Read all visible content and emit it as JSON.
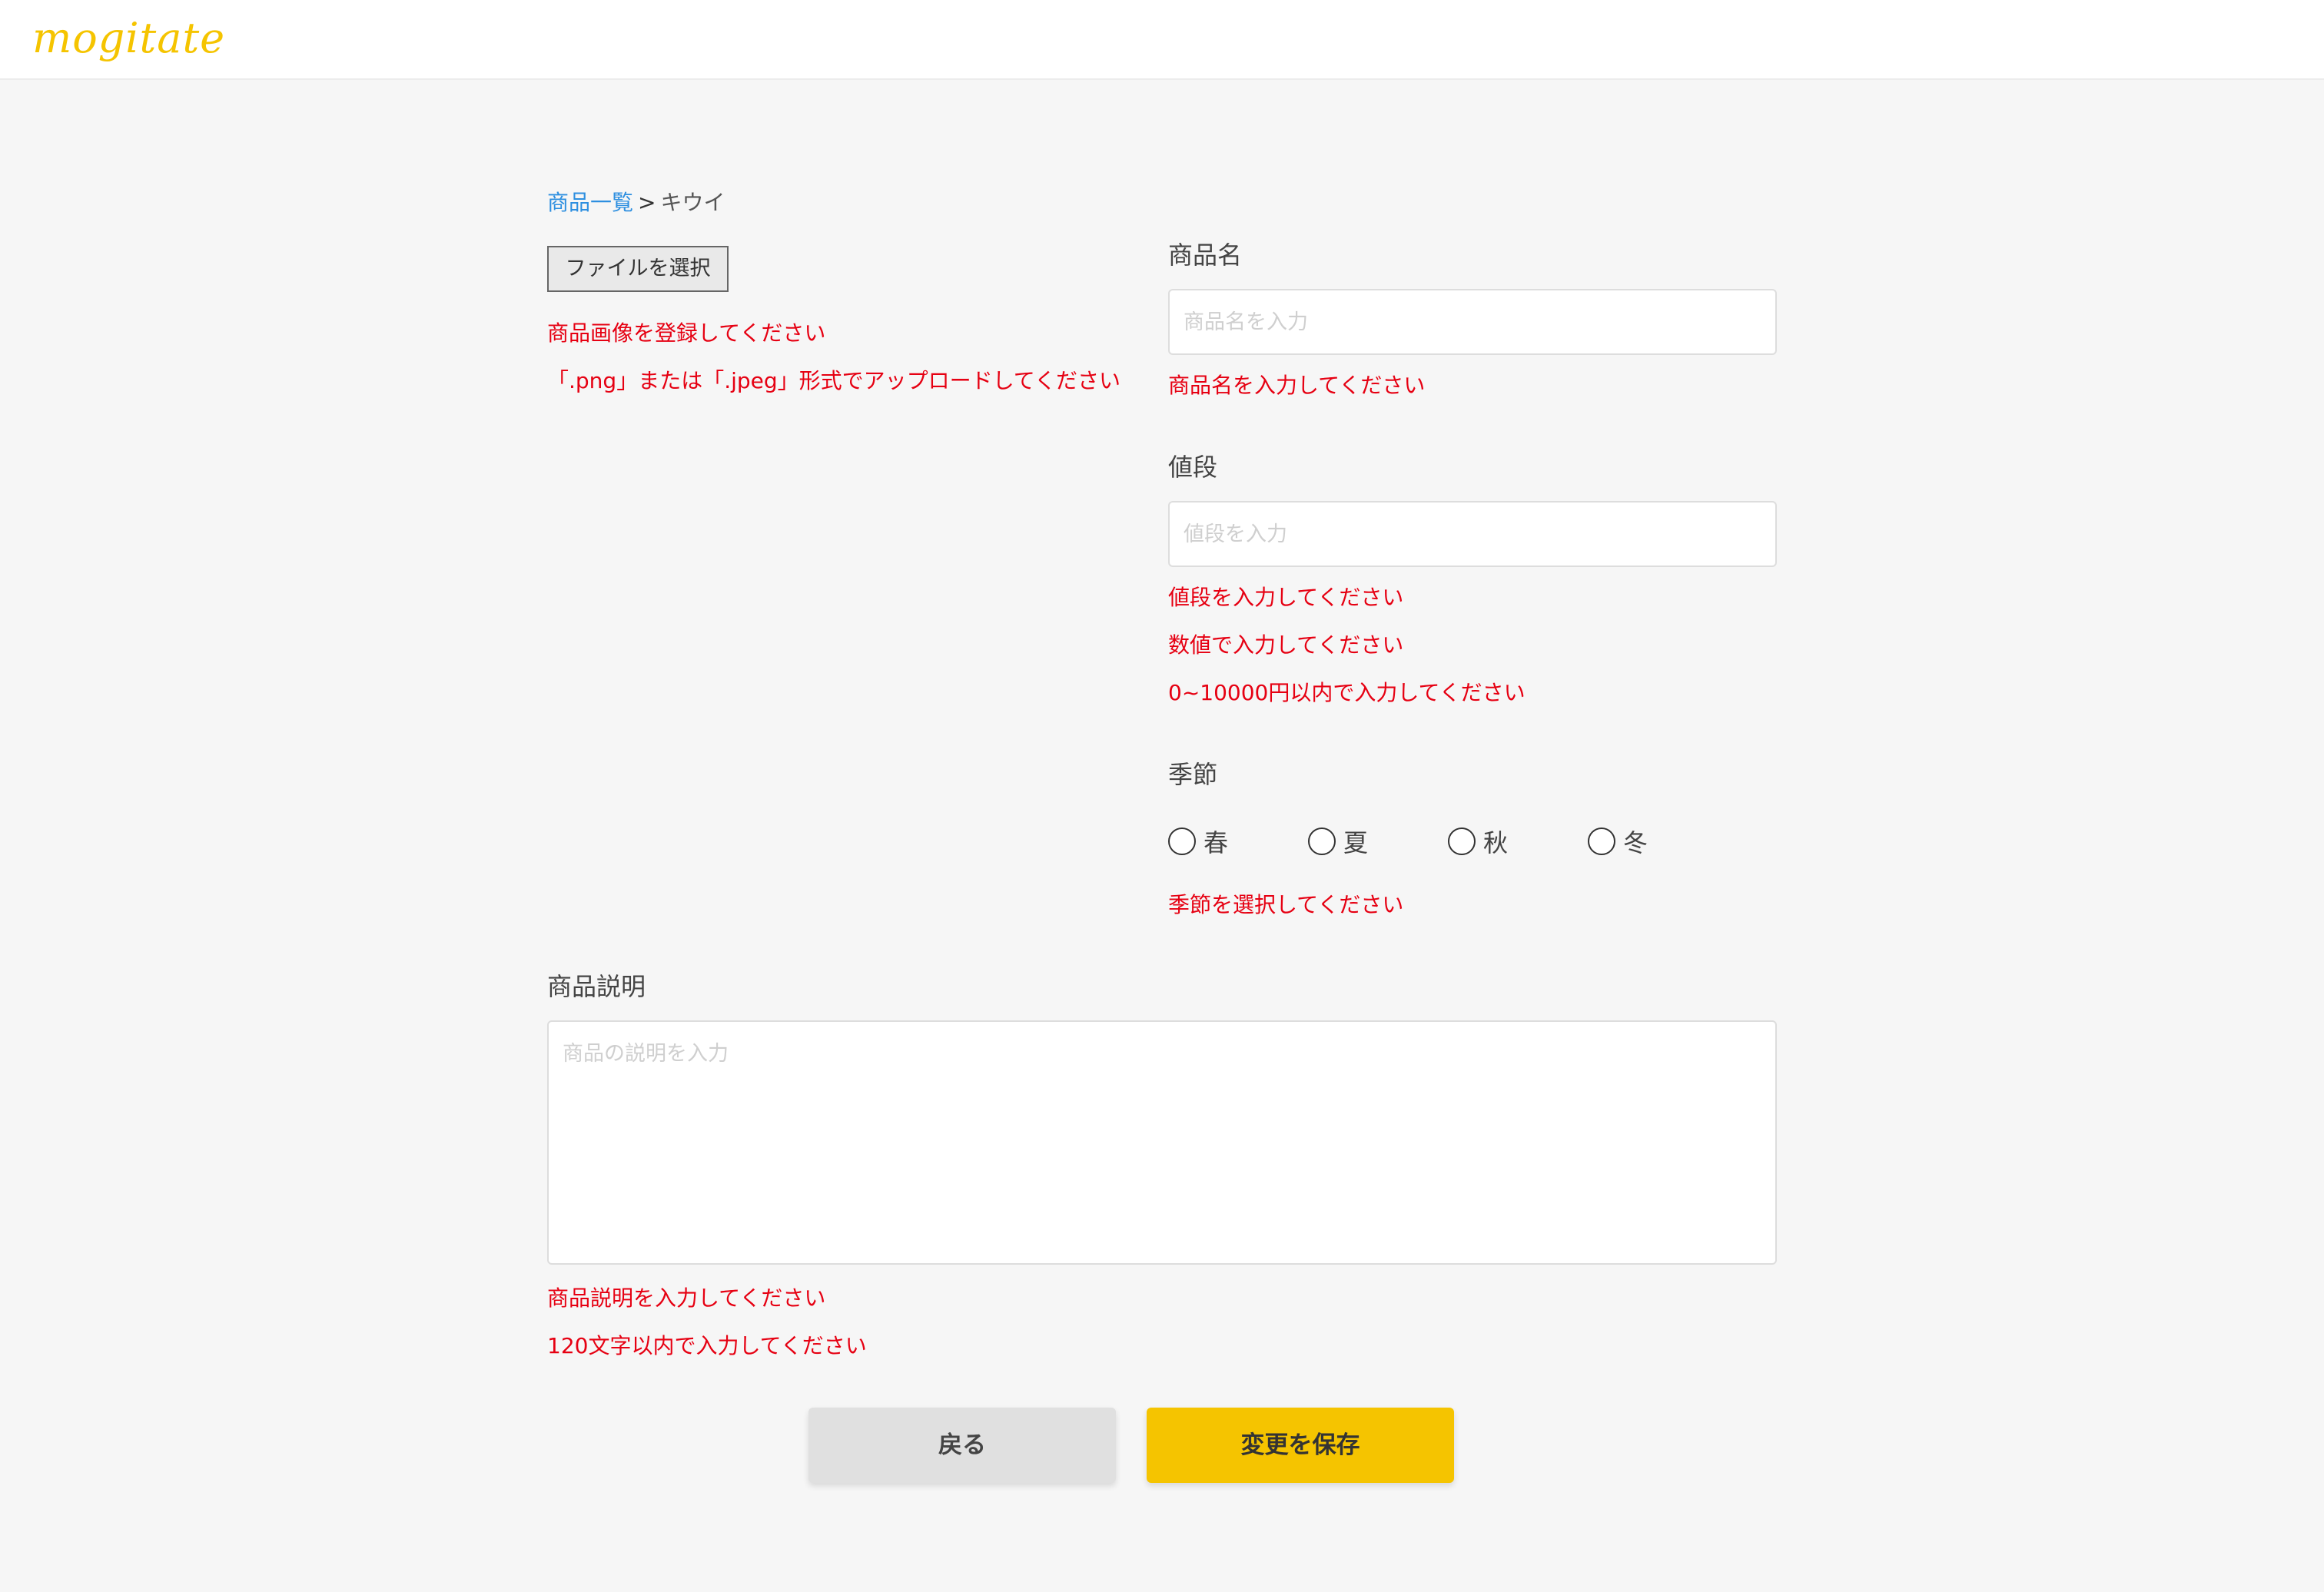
{
  "header": {
    "logo_text": "mogitate"
  },
  "breadcrumb": {
    "parent_link": "商品一覧",
    "separator": ">",
    "current": "キウイ"
  },
  "image_section": {
    "file_button_label": "ファイルを選択",
    "errors": [
      "商品画像を登録してください",
      "「.png」または「.jpeg」形式でアップロードしてください"
    ]
  },
  "name_field": {
    "label": "商品名",
    "placeholder": "商品名を入力",
    "value": "",
    "errors": [
      "商品名を入力してください"
    ]
  },
  "price_field": {
    "label": "値段",
    "placeholder": "値段を入力",
    "value": "",
    "errors": [
      "値段を入力してください",
      "数値で入力してください",
      "0~10000円以内で入力してください"
    ]
  },
  "season_field": {
    "label": "季節",
    "options": [
      "春",
      "夏",
      "秋",
      "冬"
    ],
    "errors": [
      "季節を選択してください"
    ]
  },
  "description_field": {
    "label": "商品説明",
    "placeholder": "商品の説明を入力",
    "value": "",
    "errors": [
      "商品説明を入力してください",
      "120文字以内で入力してください"
    ]
  },
  "actions": {
    "back_label": "戻る",
    "save_label": "変更を保存"
  },
  "colors": {
    "brand_yellow": "#f5c400",
    "error_red": "#e60012",
    "link_blue": "#2d8fe0",
    "background": "#f6f6f6"
  }
}
